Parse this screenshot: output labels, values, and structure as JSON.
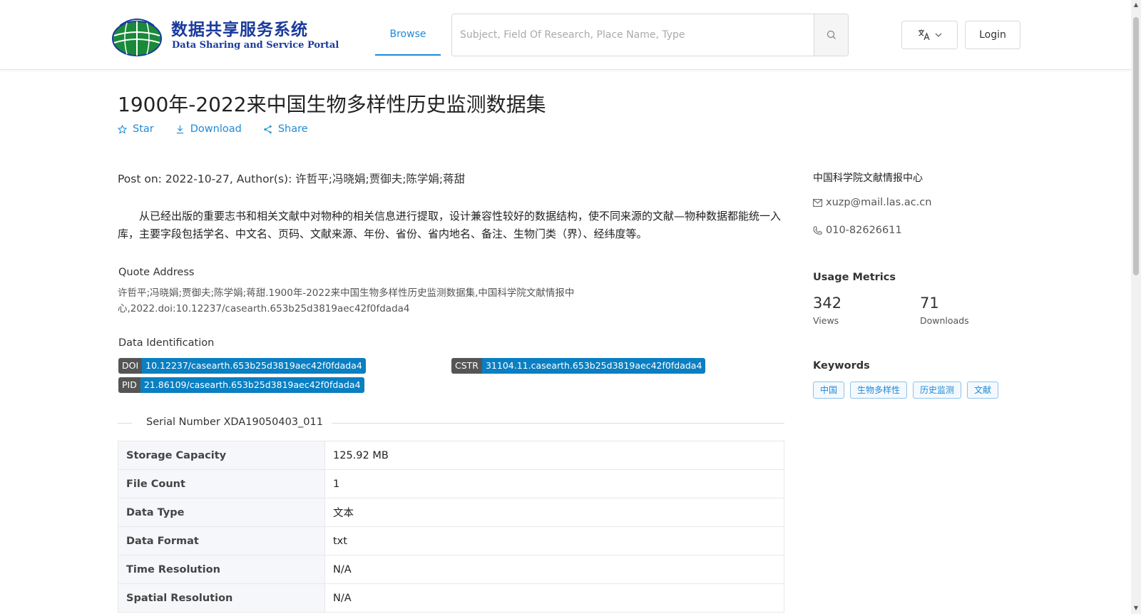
{
  "header": {
    "logo_cn": "数据共享服务系统",
    "logo_en": "Data Sharing and Service Portal",
    "nav_browse": "Browse",
    "search_placeholder": "Subject, Field Of Research, Place Name, Type",
    "login": "Login"
  },
  "dataset": {
    "title": "1900年-2022来中国生物多样性历史监测数据集",
    "actions": {
      "star": "Star",
      "download": "Download",
      "share": "Share"
    },
    "post_on": "Post on: 2022-10-27, Author(s): 许哲平;冯晓娟;贾御夫;陈学娟;蒋甜",
    "description": "从已经出版的重要志书和相关文献中对物种的相关信息进行提取，设计兼容性较好的数据结构，使不同来源的文献—物种数据都能统一入库，主要字段包括学名、中文名、页码、文献来源、年份、省份、省内地名、备注、生物门类（界）、经纬度等。",
    "quote_label": "Quote Address",
    "quote_text": "许哲平;冯晓娟;贾御夫;陈学娟;蒋甜.1900年-2022来中国生物多样性历史监测数据集,中国科学院文献情报中心,2022.doi:10.12237/casearth.653b25d3819aec42f0fdada4",
    "identification_label": "Data Identification",
    "identifiers": {
      "doi_key": "DOI",
      "doi_val": "10.12237/casearth.653b25d3819aec42f0fdada4",
      "cstr_key": "CSTR",
      "cstr_val": "31104.11.casearth.653b25d3819aec42f0fdada4",
      "pid_key": "PID",
      "pid_val": "21.86109/casearth.653b25d3819aec42f0fdada4"
    },
    "serial_number": "Serial Number XDA19050403_011",
    "details": [
      {
        "key": "Storage Capacity",
        "value": "125.92 MB"
      },
      {
        "key": "File Count",
        "value": "1"
      },
      {
        "key": "Data Type",
        "value": "文本"
      },
      {
        "key": "Data Format",
        "value": "txt"
      },
      {
        "key": "Time Resolution",
        "value": "N/A"
      },
      {
        "key": "Spatial Resolution",
        "value": "N/A"
      }
    ]
  },
  "sidebar": {
    "organization": "中国科学院文献情报中心",
    "email": "xuzp@mail.las.ac.cn",
    "phone": "010-82626611",
    "usage_heading": "Usage Metrics",
    "views_value": "342",
    "views_label": "Views",
    "downloads_value": "71",
    "downloads_label": "Downloads",
    "keywords_heading": "Keywords",
    "keywords": [
      "中国",
      "生物多样性",
      "历史监测",
      "文献"
    ]
  },
  "colors": {
    "accent": "#1f8ad6",
    "badge_key": "#555555",
    "badge_value": "#0a7fc2"
  }
}
